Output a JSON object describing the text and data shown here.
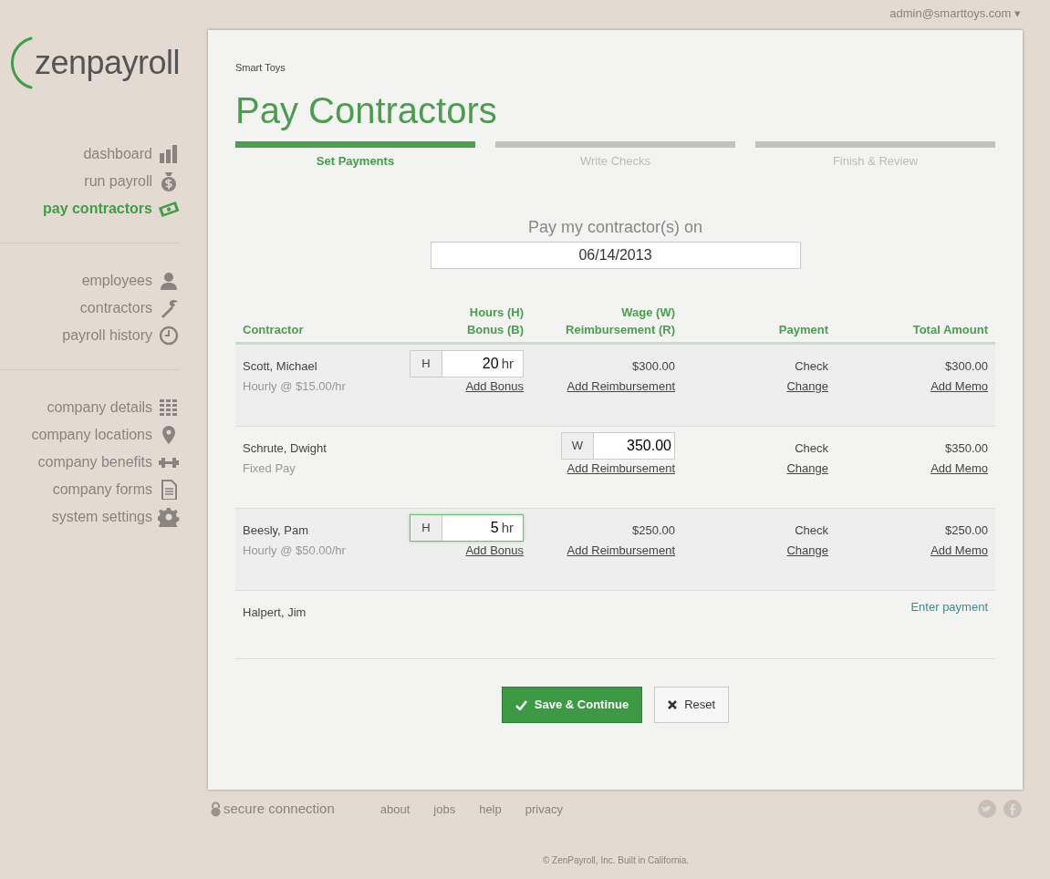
{
  "account_menu": {
    "label": "admin@smarttoys.com",
    "caret": "▾"
  },
  "logo": {
    "text": "zenpayroll"
  },
  "sidebar": {
    "groups": [
      {
        "items": [
          {
            "label": "dashboard",
            "selected": false
          },
          {
            "label": "run payroll",
            "selected": false
          },
          {
            "label": "pay contractors",
            "selected": true
          }
        ]
      },
      {
        "items": [
          {
            "label": "employees",
            "selected": false
          },
          {
            "label": "contractors",
            "selected": false
          },
          {
            "label": "payroll history",
            "selected": false
          }
        ]
      },
      {
        "items": [
          {
            "label": "company details",
            "selected": false
          },
          {
            "label": "company locations",
            "selected": false
          },
          {
            "label": "company benefits",
            "selected": false
          },
          {
            "label": "company forms",
            "selected": false
          },
          {
            "label": "system settings",
            "selected": false
          }
        ]
      }
    ]
  },
  "breadcrumb": "Smart Toys",
  "title": "Pay Contractors",
  "steps": [
    {
      "label": "Set Payments",
      "selected": true
    },
    {
      "label": "Write Checks",
      "selected": false
    },
    {
      "label": "Finish & Review",
      "selected": false
    }
  ],
  "pay_date": {
    "label": "Pay my contractor(s) on",
    "value": "06/14/2013"
  },
  "table": {
    "columns": [
      [
        "Contractor"
      ],
      [
        "Hours (H)",
        "Bonus (B)"
      ],
      [
        "Wage (W)",
        "Reimbursement (R)"
      ],
      [
        "Payment"
      ],
      [
        "Total Amount"
      ]
    ],
    "rows": [
      {
        "kind": "hourly",
        "name": "Scott, Michael",
        "pay_type": "Hourly @ $15.00/hr",
        "entry": {
          "prefix": "H",
          "value": "20",
          "unit": "hr",
          "focused": false
        },
        "wage": "$300.00",
        "bonus_link": "Add Bonus",
        "reimbursement_link": "Add Reimbursement",
        "payment": "Check",
        "change_link": "Change",
        "total": "$300.00",
        "memo_link": "Add Memo"
      },
      {
        "kind": "fixed",
        "name": "Schrute, Dwight",
        "pay_type": "Fixed Pay",
        "wage_entry": {
          "prefix": "W",
          "value": "350.00",
          "focused": false
        },
        "reimbursement_link": "Add Reimbursement",
        "payment": "Check",
        "change_link": "Change",
        "total": "$350.00",
        "memo_link": "Add Memo"
      },
      {
        "kind": "hourly",
        "name": "Beesly, Pam",
        "pay_type": "Hourly @ $50.00/hr",
        "entry": {
          "prefix": "H",
          "value": "5",
          "unit": "hr",
          "focused": true
        },
        "wage": "$250.00",
        "bonus_link": "Add Bonus",
        "reimbursement_link": "Add Reimbursement",
        "payment": "Check",
        "change_link": "Change",
        "total": "$250.00",
        "memo_link": "Add Memo"
      },
      {
        "kind": "pending",
        "name": "Halpert, Jim",
        "action_link": "Enter payment"
      }
    ]
  },
  "buttons": {
    "save": "Save & Continue",
    "reset": "Reset"
  },
  "footer": {
    "secure": "secure connection",
    "links": [
      "about",
      "jobs",
      "help",
      "privacy"
    ],
    "copyright": "© ZenPayroll, Inc. Built in California."
  }
}
